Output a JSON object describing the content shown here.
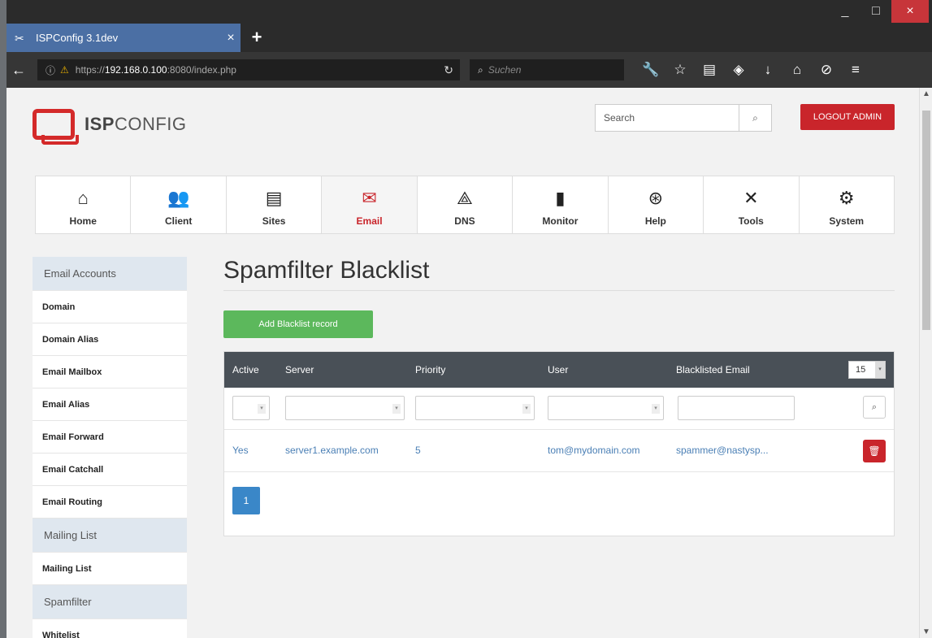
{
  "browser": {
    "tab_title": "ISPConfig 3.1dev",
    "tab_close": "×",
    "new_tab": "+",
    "url_prefix": "https://",
    "url_host": "192.168.0.100",
    "url_rest": ":8080/index.php",
    "search_placeholder": "Suchen",
    "window_controls": {
      "minimize": "_",
      "maximize": "□",
      "close": "×"
    }
  },
  "header": {
    "logo_bold": "ISP",
    "logo_rest": "CONFIG",
    "search_placeholder": "Search",
    "logout_label": "LOGOUT ADMIN"
  },
  "main_nav": [
    {
      "label": "Home",
      "icon": "home-icon",
      "glyph": "⌂"
    },
    {
      "label": "Client",
      "icon": "users-icon",
      "glyph": "👥"
    },
    {
      "label": "Sites",
      "icon": "sites-icon",
      "glyph": "▤"
    },
    {
      "label": "Email",
      "icon": "email-icon",
      "glyph": "✉",
      "active": true
    },
    {
      "label": "DNS",
      "icon": "dns-icon",
      "glyph": "⟁"
    },
    {
      "label": "Monitor",
      "icon": "monitor-icon",
      "glyph": "▮"
    },
    {
      "label": "Help",
      "icon": "help-icon",
      "glyph": "⊛"
    },
    {
      "label": "Tools",
      "icon": "tools-icon",
      "glyph": "✕"
    },
    {
      "label": "System",
      "icon": "gear-icon",
      "glyph": "⚙"
    }
  ],
  "sidebar": {
    "sections": [
      {
        "title": "Email Accounts",
        "items": [
          "Domain",
          "Domain Alias",
          "Email Mailbox",
          "Email Alias",
          "Email Forward",
          "Email Catchall",
          "Email Routing"
        ]
      },
      {
        "title": "Mailing List",
        "items": [
          "Mailing List"
        ]
      },
      {
        "title": "Spamfilter",
        "items": [
          "Whitelist"
        ]
      }
    ]
  },
  "content": {
    "title": "Spamfilter Blacklist",
    "add_button": "Add Blacklist record",
    "columns": [
      "Active",
      "Server",
      "Priority",
      "User",
      "Blacklisted Email"
    ],
    "per_page": "15",
    "rows": [
      {
        "active": "Yes",
        "server": "server1.example.com",
        "priority": "5",
        "user": "tom@mydomain.com",
        "email": "spammer@nastysp..."
      }
    ],
    "page": "1"
  }
}
